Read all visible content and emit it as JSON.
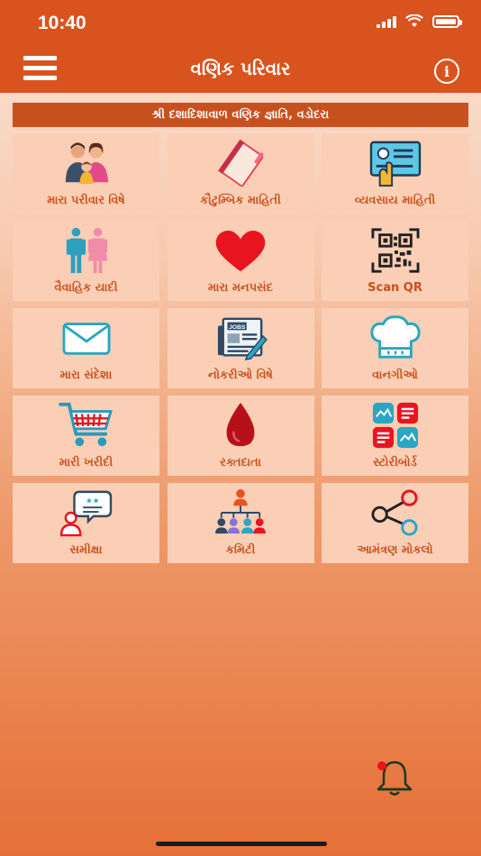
{
  "status_bar": {
    "time": "10:40"
  },
  "header": {
    "title": "વણિક પરિવાર",
    "info_icon": "i"
  },
  "banner": {
    "text": "શ્રી દશાદિશાવાળ વણિક જ્ઞાતિ, વડોદરા"
  },
  "tiles": [
    {
      "label": "મારા પરીવાર વિષે",
      "icon": "family-icon"
    },
    {
      "label": "કૌટુમ્બિક માહિતી",
      "icon": "notebook-icon"
    },
    {
      "label": "વ્યવસાય માહિતી",
      "icon": "id-card-icon"
    },
    {
      "label": "વૈવાહિક યાદી",
      "icon": "couple-icon"
    },
    {
      "label": "મારા મનપસંદ",
      "icon": "heart-icon"
    },
    {
      "label": "Scan QR",
      "icon": "qr-code-icon"
    },
    {
      "label": "મારા સંદેશા",
      "icon": "envelope-icon"
    },
    {
      "label": "નોકરીઓ વિષે",
      "icon": "jobs-newspaper-icon"
    },
    {
      "label": "વાનગીઓ",
      "icon": "chef-hat-icon"
    },
    {
      "label": "મારી ખરીદી",
      "icon": "shopping-cart-icon"
    },
    {
      "label": "રક્તદાતા",
      "icon": "blood-drop-icon"
    },
    {
      "label": "સ્ટોરીબોર્ડ",
      "icon": "storyboard-icon"
    },
    {
      "label": "સમીક્ષા",
      "icon": "review-icon"
    },
    {
      "label": "કમિટી",
      "icon": "committee-icon"
    },
    {
      "label": "આમંત્રણ મોકલો",
      "icon": "share-icon"
    }
  ],
  "colors": {
    "accent": "#d9531e",
    "tile_bg": "#fbcfb5",
    "label": "#c8501f"
  }
}
